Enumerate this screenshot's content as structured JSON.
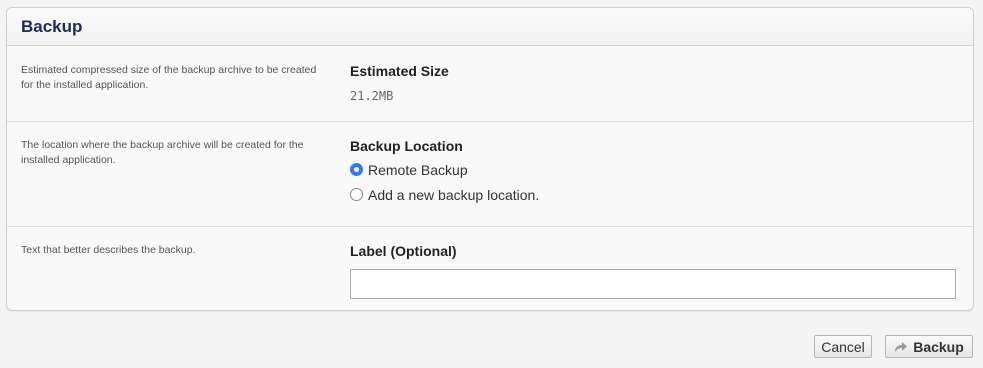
{
  "panel": {
    "title": "Backup"
  },
  "rows": [
    {
      "description": "Estimated compressed size of the backup archive to be created for the installed application.",
      "label": "Estimated Size",
      "value": "21.2MB"
    },
    {
      "description": "The location where the backup archive will be created for the installed application.",
      "label": "Backup Location",
      "options": [
        {
          "label": "Remote Backup",
          "checked": true
        },
        {
          "label": "Add a new backup location.",
          "checked": false
        }
      ]
    },
    {
      "description": "Text that better describes the backup.",
      "label": "Label (Optional)",
      "input_value": ""
    }
  ],
  "buttons": {
    "cancel": "Cancel",
    "backup": "Backup",
    "backup_icon": "share-arrow-icon"
  },
  "colors": {
    "title": "#1f2a5a",
    "radio_selected": "#3478f6"
  }
}
